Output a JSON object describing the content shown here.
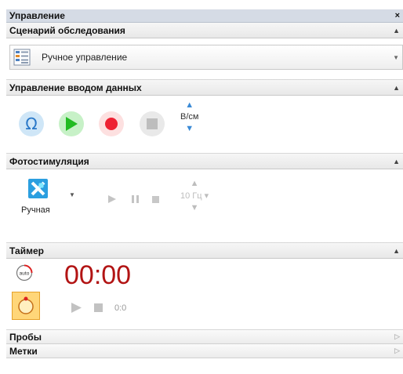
{
  "panel": {
    "title": "Управление",
    "close_glyph": "×"
  },
  "scenario": {
    "header": "Сценарий обследования",
    "selected": "Ручное управление",
    "icon": "document-list-icon"
  },
  "data_input": {
    "header": "Управление вводом данных",
    "buttons": [
      "omega-icon",
      "play-icon",
      "record-icon",
      "stop-icon"
    ],
    "omega_glyph": "Ω",
    "scale_value": "В/см"
  },
  "photostim": {
    "header": "Фотостимуляция",
    "mode_label": "Ручная",
    "frequency": "10 Гц",
    "freq_dropdown": "▾"
  },
  "timer": {
    "header": "Таймер",
    "auto_label": "auto",
    "display": "00:00",
    "count": "0:0"
  },
  "collapsed_sections": {
    "probes": "Пробы",
    "marks": "Метки"
  },
  "colors": {
    "accent": "#2b9fe0",
    "timer": "#b21414",
    "play": "#22bb22",
    "record": "#ee2233"
  }
}
